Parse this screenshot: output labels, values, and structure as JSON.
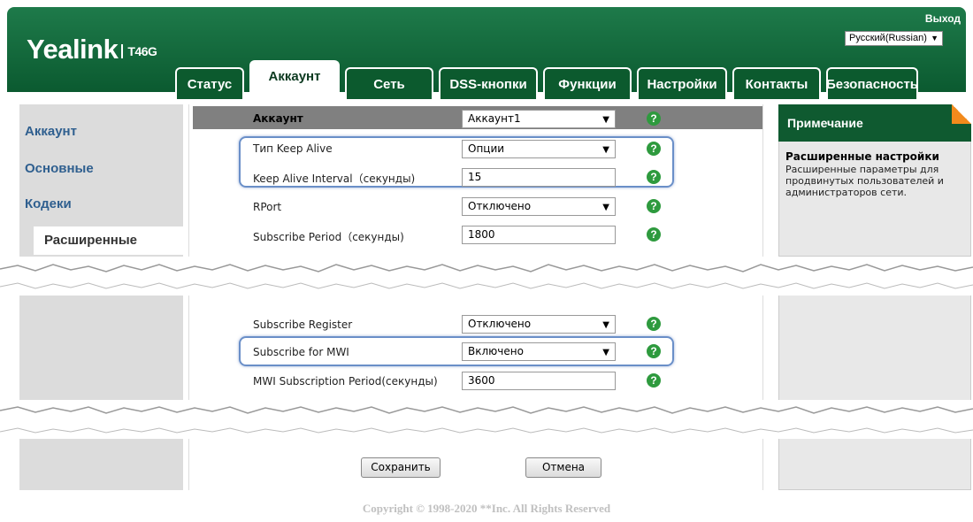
{
  "header": {
    "brand": "Yealink",
    "model": "T46G",
    "logout_label": "Выход",
    "language": "Русский(Russian)",
    "colors": {
      "header_green": "#0b5a30",
      "help_green": "#2e9a3e",
      "link_blue": "#2f5f8f",
      "corner_orange": "#f28a1c"
    }
  },
  "tabs": [
    {
      "label": "Статус"
    },
    {
      "label": "Аккаунт"
    },
    {
      "label": "Сеть"
    },
    {
      "label": "DSS-кнопки"
    },
    {
      "label": "Функции"
    },
    {
      "label": "Настройки"
    },
    {
      "label": "Контакты"
    },
    {
      "label": "Безопасность"
    }
  ],
  "sidebar": {
    "items": [
      {
        "label": "Аккаунт"
      },
      {
        "label": "Основные"
      },
      {
        "label": "Кодеки"
      },
      {
        "label": "Расширенные"
      }
    ]
  },
  "form": {
    "account": {
      "label": "Аккаунт",
      "value": "Аккаунт1"
    },
    "keepalive_type": {
      "label": "Тип Keep Alive",
      "value": "Опции"
    },
    "keepalive_interval": {
      "label": "Keep Alive Interval（секунды)",
      "value": "15"
    },
    "rport": {
      "label": "RPort",
      "value": "Отключено"
    },
    "subscribe_period": {
      "label": "Subscribe Period（секунды)",
      "value": "1800"
    },
    "subscribe_register": {
      "label": "Subscribe Register",
      "value": "Отключено"
    },
    "subscribe_mwi": {
      "label": "Subscribe for MWI",
      "value": "Включено"
    },
    "mwi_period": {
      "label": "MWI Subscription Period(секунды)",
      "value": "3600"
    }
  },
  "help_icon": "?",
  "notes": {
    "header": "Примечание",
    "title": "Расширенные настройки",
    "text": "Расширенные параметры для продвинутых пользователей и администраторов сети."
  },
  "buttons": {
    "save": "Сохранить",
    "cancel": "Отмена"
  },
  "footer": {
    "copyright": "Copyright © 1998-2020 **Inc. All Rights Reserved"
  }
}
